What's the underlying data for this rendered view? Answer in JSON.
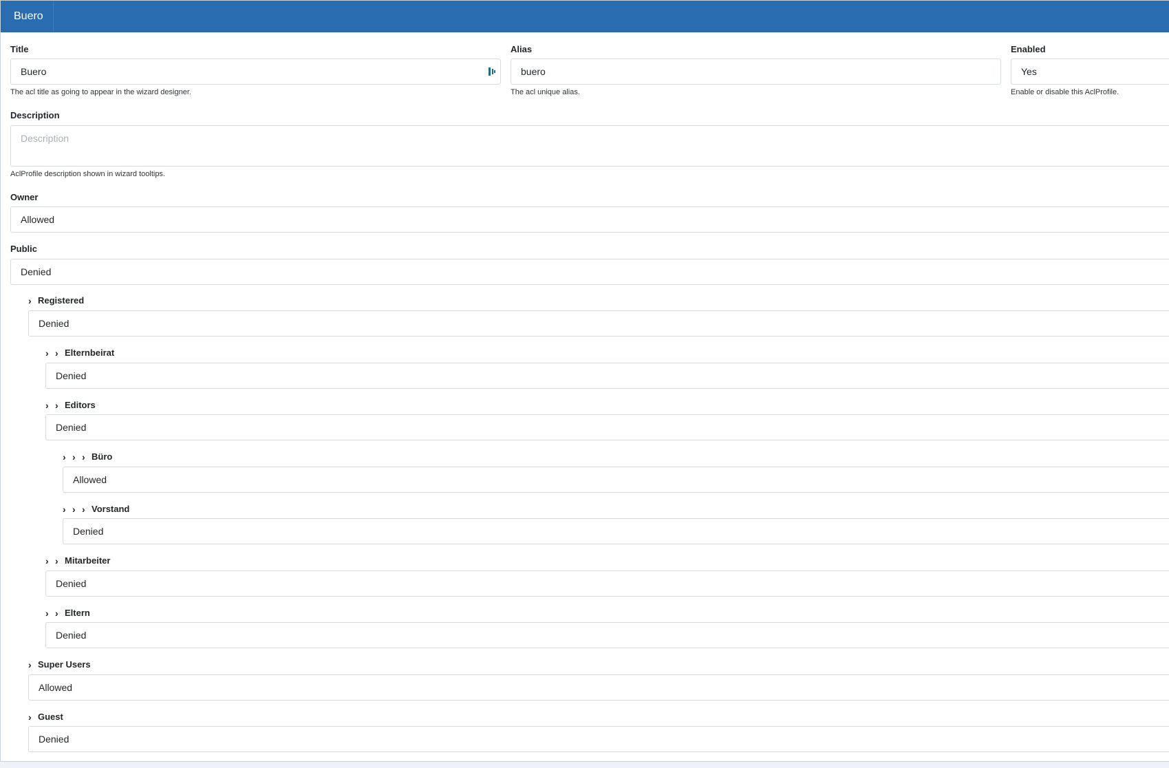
{
  "header": {
    "title": "Buero"
  },
  "form": {
    "title": {
      "label": "Title",
      "value": "Buero",
      "help": "The acl title as going to appear in the wizard designer."
    },
    "alias": {
      "label": "Alias",
      "value": "buero",
      "help": "The acl unique alias."
    },
    "enabled": {
      "label": "Enabled",
      "value": "Yes",
      "help": "Enable or disable this AclProfile."
    },
    "description": {
      "label": "Description",
      "placeholder": "Description",
      "help": "AclProfile description shown in wizard tooltips."
    },
    "owner": {
      "label": "Owner",
      "value": "Allowed"
    },
    "public": {
      "label": "Public",
      "value": "Denied"
    }
  },
  "groups": [
    {
      "label": "Registered",
      "value": "Denied",
      "depth": 1
    },
    {
      "label": "Elternbeirat",
      "value": "Denied",
      "depth": 2
    },
    {
      "label": "Editors",
      "value": "Denied",
      "depth": 2
    },
    {
      "label": "Büro",
      "value": "Allowed",
      "depth": 3
    },
    {
      "label": "Vorstand",
      "value": "Denied",
      "depth": 3
    },
    {
      "label": "Mitarbeiter",
      "value": "Denied",
      "depth": 2
    },
    {
      "label": "Eltern",
      "value": "Denied",
      "depth": 2
    },
    {
      "label": "Super Users",
      "value": "Allowed",
      "depth": 1
    },
    {
      "label": "Guest",
      "value": "Denied",
      "depth": 1
    }
  ],
  "icons": {
    "chevron": "chevron-right-icon",
    "title_field": "grip-icon"
  },
  "colors": {
    "header": "#2a6cb0",
    "icon_accent": "#1e6b8a"
  }
}
